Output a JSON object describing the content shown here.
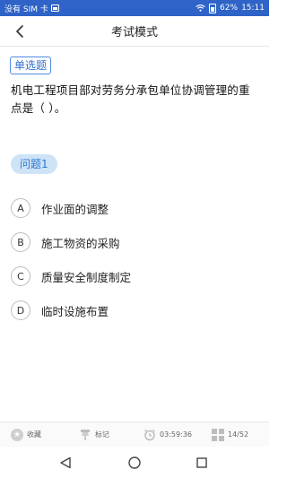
{
  "status_bar": {
    "carrier": "没有 SIM 卡",
    "battery": "62%",
    "time": "15:11"
  },
  "header": {
    "title": "考试模式"
  },
  "question": {
    "type_label": "单选题",
    "text": "机电工程项目部对劳务分承包单位协调管理的重点是（ ）。",
    "number_label": "问题1"
  },
  "options": [
    {
      "letter": "A",
      "text": "作业面的调整"
    },
    {
      "letter": "B",
      "text": "施工物资的采购"
    },
    {
      "letter": "C",
      "text": "质量安全制度制定"
    },
    {
      "letter": "D",
      "text": "临时设施布置"
    }
  ],
  "bottom_bar": {
    "favorite_label": "收藏",
    "mark_label": "标记",
    "timer": "03:59:36",
    "progress": "14/52"
  },
  "colors": {
    "status_bar": "#2f63c7",
    "accent": "#2f6fcf",
    "pill_bg": "#cfe3f7"
  }
}
